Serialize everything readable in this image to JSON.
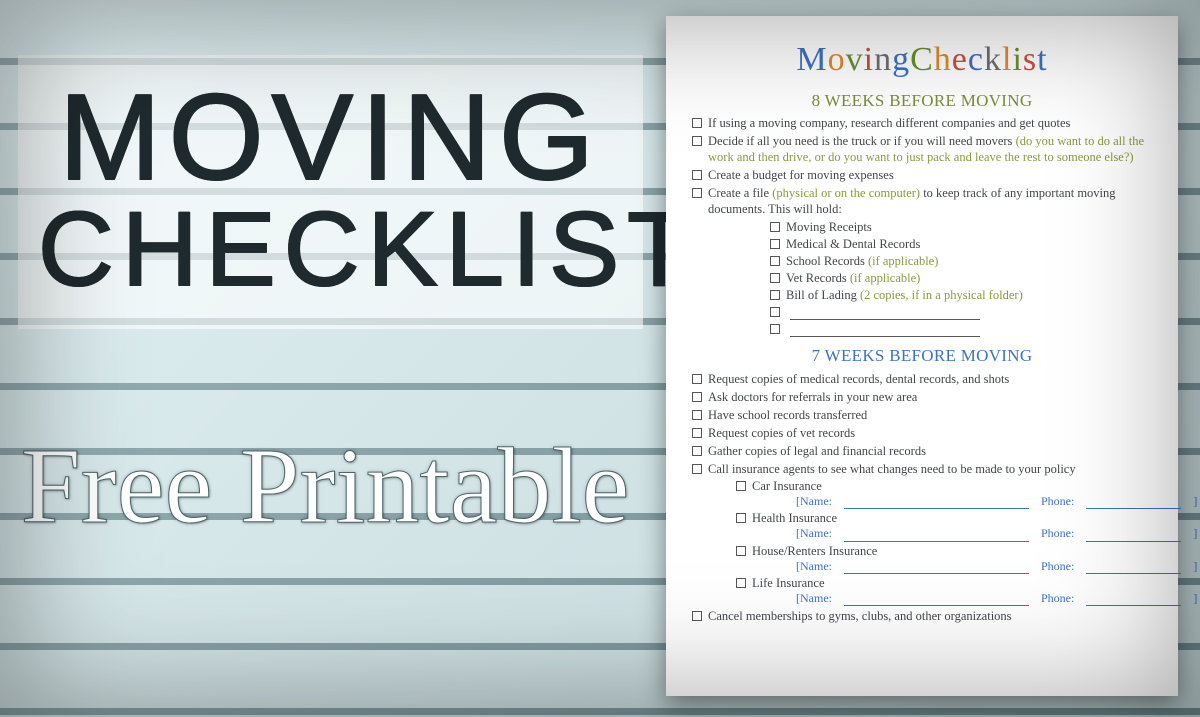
{
  "banner": {
    "line1": "MOVING",
    "line2": "CHECKLIST",
    "subtitle": "Free Printable"
  },
  "sheet": {
    "title_letters": [
      {
        "t": "M",
        "c": "c-blue"
      },
      {
        "t": "o",
        "c": "c-orange"
      },
      {
        "t": "v",
        "c": "c-green"
      },
      {
        "t": "i",
        "c": "c-red"
      },
      {
        "t": "n",
        "c": "c-gray"
      },
      {
        "t": "g",
        "c": "c-blue"
      },
      {
        "t": " ",
        "c": ""
      },
      {
        "t": "C",
        "c": "c-green"
      },
      {
        "t": "h",
        "c": "c-orange"
      },
      {
        "t": "e",
        "c": "c-red"
      },
      {
        "t": "c",
        "c": "c-blue"
      },
      {
        "t": "k",
        "c": "c-gray"
      },
      {
        "t": "l",
        "c": "c-orange"
      },
      {
        "t": "i",
        "c": "c-green"
      },
      {
        "t": "s",
        "c": "c-red"
      },
      {
        "t": "t",
        "c": "c-blue"
      }
    ],
    "sec8_title": "8 WEEKS BEFORE MOVING",
    "sec8_items": {
      "i1": "If using a moving company, research different companies and get quotes",
      "i2a": "Decide if all you need is the truck or if you will need movers ",
      "i2b": "(do you want to do all the work and then drive, or do you want to just pack and leave the rest to someone else?)",
      "i3": "Create a budget for moving expenses",
      "i4a": "Create a file ",
      "i4b": "(physical or on the computer)",
      "i4c": " to keep track of any important moving documents. This will hold:",
      "sub": {
        "s1": "Moving Receipts",
        "s2": "Medical & Dental Records",
        "s3a": "School Records ",
        "s3b": "(if applicable)",
        "s4a": "Vet Records ",
        "s4b": "(if applicable)",
        "s5a": "Bill of Lading ",
        "s5b": "(2 copies, if in a physical folder)"
      }
    },
    "sec7_title": "7 WEEKS BEFORE MOVING",
    "sec7_items": {
      "i1": "Request copies of medical records, dental records, and shots",
      "i2": "Ask doctors for referrals in your new area",
      "i3": "Have school records transferred",
      "i4": "Request copies of vet records",
      "i5": "Gather copies of legal and financial records",
      "i6": "Call insurance agents to see what changes need to be made to your policy",
      "ins": {
        "a": "Car Insurance",
        "b": "Health Insurance",
        "c": "House/Renters Insurance",
        "d": "Life Insurance"
      },
      "name_label": "[Name:",
      "phone_label": "Phone:",
      "close_bracket": "]",
      "i7": "Cancel memberships to gyms, clubs, and other organizations"
    }
  }
}
